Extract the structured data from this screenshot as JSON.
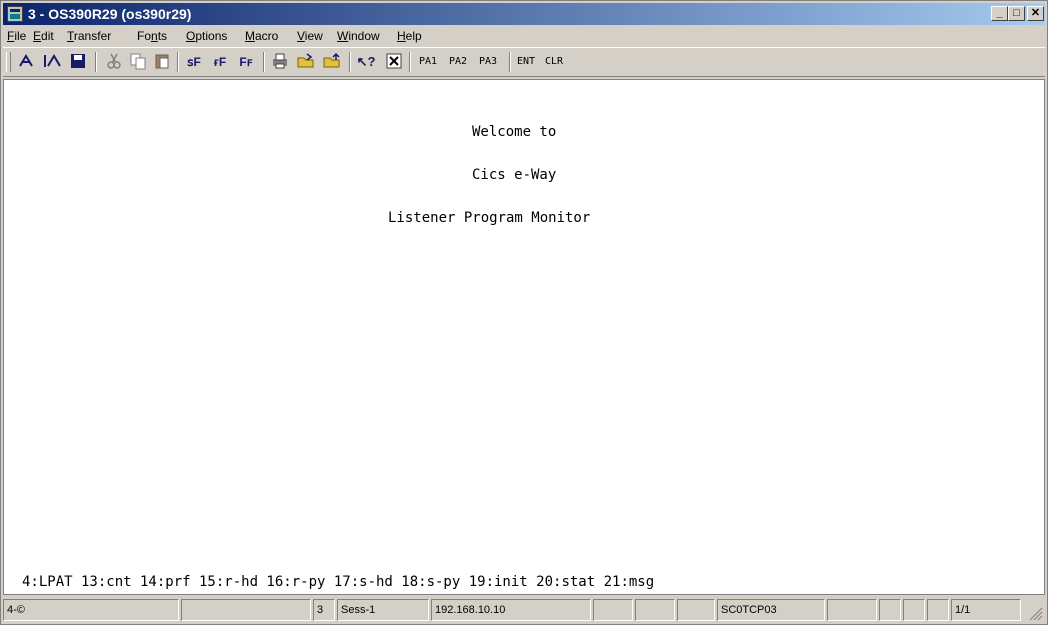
{
  "window": {
    "title": "3 - OS390R29 (os390r29)",
    "minimize_symbol": "_",
    "maximize_symbol": "□",
    "close_symbol": "✕"
  },
  "menu": [
    {
      "pre": "",
      "accel": "F",
      "post": "ile"
    },
    {
      "pre": "",
      "accel": "E",
      "post": "dit"
    },
    {
      "pre": "",
      "accel": "T",
      "post": "ransfer"
    },
    {
      "pre": "Fo",
      "accel": "n",
      "post": "ts"
    },
    {
      "pre": "",
      "accel": "O",
      "post": "ptions"
    },
    {
      "pre": "",
      "accel": "M",
      "post": "acro"
    },
    {
      "pre": "",
      "accel": "V",
      "post": "iew"
    },
    {
      "pre": "",
      "accel": "W",
      "post": "indow"
    },
    {
      "pre": "",
      "accel": "H",
      "post": "elp"
    }
  ],
  "toolbar": {
    "icons": [
      "send-file-icon",
      "receive-file-icon",
      "save-icon",
      "cut-icon",
      "copy-icon",
      "paste-icon",
      "font-small-icon",
      "font-medium-icon",
      "font-large-icon",
      "print-icon",
      "open-icon",
      "open-alt-icon",
      "help-pointer-icon",
      "close-box-icon"
    ],
    "text_buttons": [
      "PA1",
      "PA2",
      "PA3",
      "ENT",
      "CLR"
    ]
  },
  "screen": {
    "line1": "Welcome to",
    "line2": "Cics e-Way",
    "line3": "Listener Program Monitor",
    "pf_keys": "4:LPAT 13:cnt 14:prf 15:r-hd 16:r-py 17:s-hd 18:s-py 19:init 20:stat 21:msg"
  },
  "status": {
    "cursor_indicator": "4-©",
    "session_number": "3",
    "session_name": "Sess-1",
    "host_ip": "192.168.10.10",
    "lu_name": "SC0TCP03",
    "page": "1/1"
  }
}
